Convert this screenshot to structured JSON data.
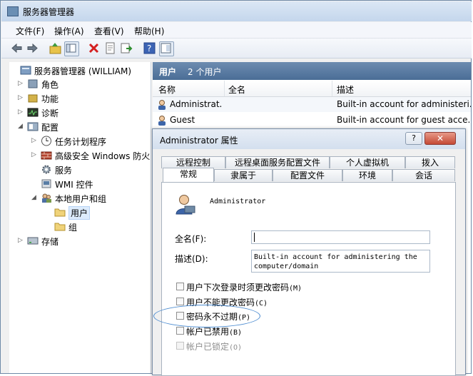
{
  "window": {
    "title": "服务器管理器"
  },
  "menu": [
    "文件(F)",
    "操作(A)",
    "查看(V)",
    "帮助(H)"
  ],
  "toolbar": [
    "back-icon",
    "forward-icon",
    "up-icon",
    "show-tree-icon",
    "delete-icon",
    "properties-icon",
    "export-icon",
    "help-icon",
    "console-icon"
  ],
  "tree": {
    "root": "服务器管理器 (WILLIAM)",
    "items": [
      "角色",
      "功能",
      "诊断",
      "配置",
      "任务计划程序",
      "高级安全 Windows 防火",
      "服务",
      "WMI 控件",
      "本地用户和组",
      "用户",
      "组",
      "存储"
    ]
  },
  "right": {
    "header_title": "用户",
    "header_count": "2 个用户",
    "columns": [
      "名称",
      "全名",
      "描述"
    ],
    "rows": [
      {
        "name": "Administrat...",
        "fullname": "",
        "desc": "Built-in account for administeri..."
      },
      {
        "name": "Guest",
        "fullname": "",
        "desc": "Built-in account for guest acce..."
      }
    ]
  },
  "dialog": {
    "title": "Administrator 属性",
    "help": "?",
    "close": "✕",
    "tabs_back": [
      "远程控制",
      "远程桌面服务配置文件",
      "个人虚拟机",
      "拨入"
    ],
    "tabs_front": [
      "常规",
      "隶属于",
      "配置文件",
      "环境",
      "会话"
    ],
    "username": "Administrator",
    "fullname_label": "全名(F):",
    "fullname_value": "",
    "desc_label": "描述(D):",
    "desc_value": "Built-in account for administering the computer/domain",
    "checkboxes": [
      {
        "label": "用户下次登录时须更改密码",
        "key": "(M)",
        "checked": false,
        "disabled": false
      },
      {
        "label": "用户不能更改密码",
        "key": "(C)",
        "checked": false,
        "disabled": false
      },
      {
        "label": "密码永不过期",
        "key": "(P)",
        "checked": false,
        "disabled": false
      },
      {
        "label": "帐户已禁用",
        "key": "(B)",
        "checked": false,
        "disabled": false
      },
      {
        "label": "帐户已锁定",
        "key": "(O)",
        "checked": false,
        "disabled": true
      }
    ]
  },
  "colors": {
    "accent": "#4a6d96",
    "selection": "#dcebfc",
    "highlight_oval": "#4b8bd0"
  }
}
